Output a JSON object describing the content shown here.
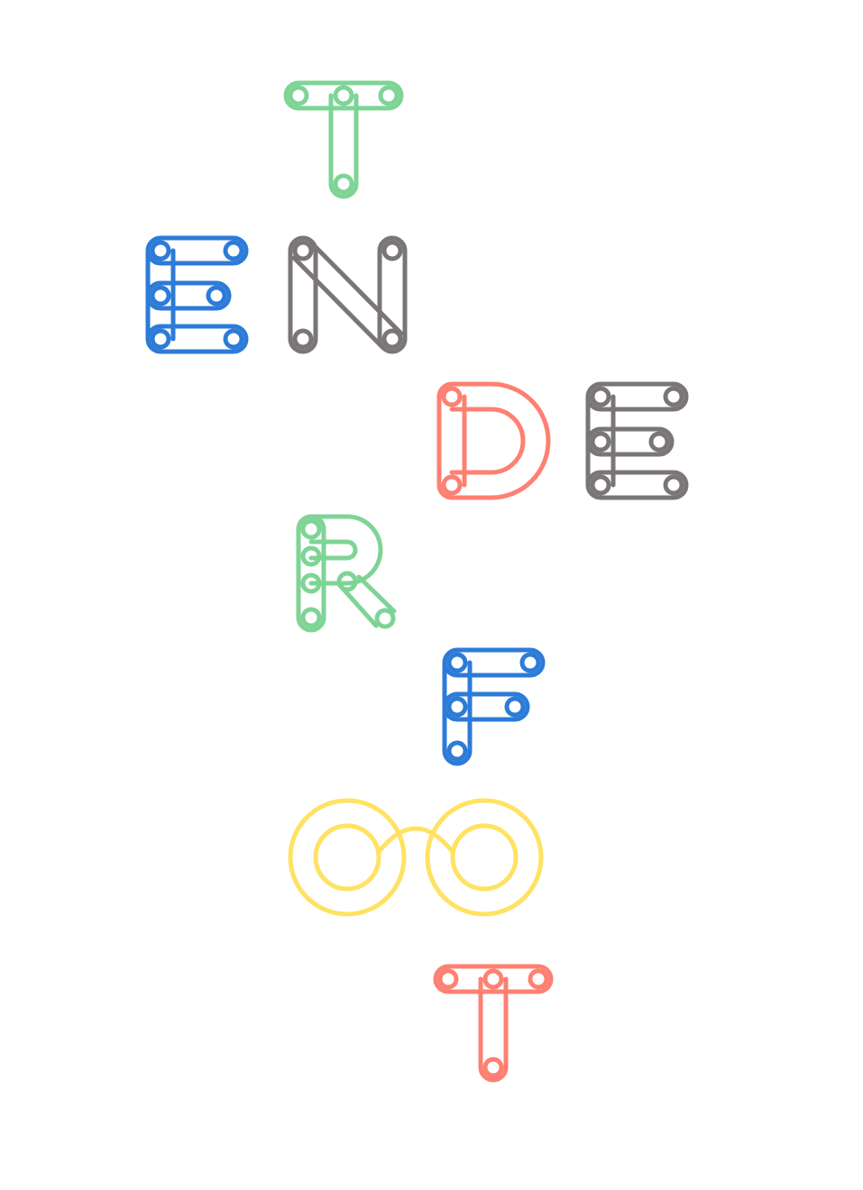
{
  "letters": [
    {
      "char": "T",
      "color": "#7ed495"
    },
    {
      "char": "E",
      "color": "#2d7bd8"
    },
    {
      "char": "N",
      "color": "#7b7676"
    },
    {
      "char": "D",
      "color": "#fe8072"
    },
    {
      "char": "E",
      "color": "#7b7676"
    },
    {
      "char": "R",
      "color": "#7ed495"
    },
    {
      "char": "F",
      "color": "#2d7bd8"
    },
    {
      "char": "O",
      "color": "#ffe262"
    },
    {
      "char": "T",
      "color": "#fe8072"
    }
  ],
  "word": "TENDERFOOT"
}
